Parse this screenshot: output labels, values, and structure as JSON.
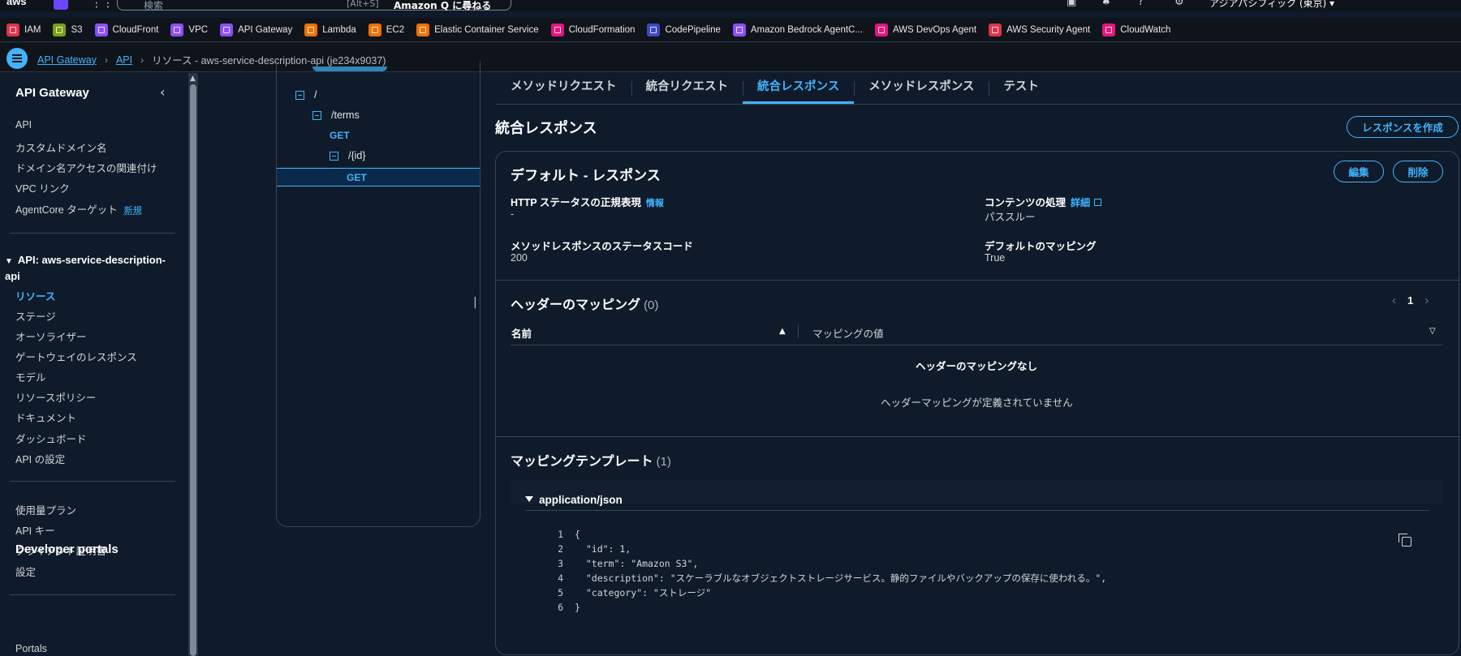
{
  "topnav": {
    "logo": "aws",
    "search_placeholder": "検索",
    "search_shortcut": "[Alt+S]",
    "amazon_q": "Amazon Q に尋ねる",
    "region": "アジアパシフィック (東京) ▾"
  },
  "favorites": [
    {
      "label": "IAM",
      "color": "#dd344c"
    },
    {
      "label": "S3",
      "color": "#7aa116"
    },
    {
      "label": "CloudFront",
      "color": "#8c4fff"
    },
    {
      "label": "VPC",
      "color": "#8c4fff"
    },
    {
      "label": "API Gateway",
      "color": "#8c4fff"
    },
    {
      "label": "Lambda",
      "color": "#ed7100"
    },
    {
      "label": "EC2",
      "color": "#ed7100"
    },
    {
      "label": "Elastic Container Service",
      "color": "#ed7100"
    },
    {
      "label": "CloudFormation",
      "color": "#e7157b"
    },
    {
      "label": "CodePipeline",
      "color": "#3b48cc"
    },
    {
      "label": "Amazon Bedrock AgentC...",
      "color": "#8c4fff"
    },
    {
      "label": "AWS DevOps Agent",
      "color": "#e7157b"
    },
    {
      "label": "AWS Security Agent",
      "color": "#dd344c"
    },
    {
      "label": "CloudWatch",
      "color": "#e7157b"
    }
  ],
  "breadcrumb": {
    "item1": "API Gateway",
    "item2": "API",
    "current": "リソース - aws-service-description-api (je234x9037)"
  },
  "sidebar": {
    "title": "API Gateway",
    "top_links": [
      "API",
      "カスタムドメイン名",
      "ドメイン名アクセスの関連付け",
      "VPC リンク"
    ],
    "agentcore": "AgentCore ターゲット",
    "new_tag": "新規",
    "api_head": "API: aws-service-description-api",
    "api_links": [
      "リソース",
      "ステージ",
      "オーソライザー",
      "ゲートウェイのレスポンス",
      "モデル",
      "リソースポリシー",
      "ドキュメント",
      "ダッシュボード",
      "API の設定"
    ],
    "bottom_links": [
      "使用量プラン",
      "API キー",
      "クライアント証明書",
      "設定"
    ],
    "dev_title": "Developer portals",
    "dev_link": "Portals"
  },
  "tree": {
    "root": "/",
    "terms": "/terms",
    "get1": "GET",
    "id": "/{id}",
    "get2": "GET"
  },
  "tabs": [
    "メソッドリクエスト",
    "統合リクエスト",
    "統合レスポンス",
    "メソッドレスポンス",
    "テスト"
  ],
  "main": {
    "title": "統合レスポンス",
    "create_btn": "レスポンスを作成",
    "card_title": "デフォルト - レスポンス",
    "edit_btn": "編集",
    "delete_btn": "削除",
    "http_regex_label": "HTTP ステータスの正規表現",
    "info": "情報",
    "http_regex_value": "-",
    "content_label": "コンテンツの処理",
    "details": "詳細",
    "content_value": "パススルー",
    "status_label": "メソッドレスポンスのステータスコード",
    "status_value": "200",
    "default_label": "デフォルトのマッピング",
    "default_value": "True"
  },
  "headers": {
    "title": "ヘッダーのマッピング",
    "count": "(0)",
    "page": "1",
    "col_name": "名前",
    "col_value": "マッピングの値",
    "empty_title": "ヘッダーのマッピングなし",
    "empty_sub": "ヘッダーマッピングが定義されていません"
  },
  "templates": {
    "title": "マッピングテンプレート",
    "count": "(1)",
    "content_type": "application/json",
    "lines": [
      {
        "n": "1",
        "t": "{"
      },
      {
        "n": "2",
        "t": "  \"id\": 1,"
      },
      {
        "n": "3",
        "t": "  \"term\": \"Amazon S3\","
      },
      {
        "n": "4",
        "t": "  \"description\": \"スケーラブルなオブジェクトストレージサービス。静的ファイルやバックアップの保存に使われる。\","
      },
      {
        "n": "5",
        "t": "  \"category\": \"ストレージ\""
      },
      {
        "n": "6",
        "t": "}"
      }
    ]
  }
}
